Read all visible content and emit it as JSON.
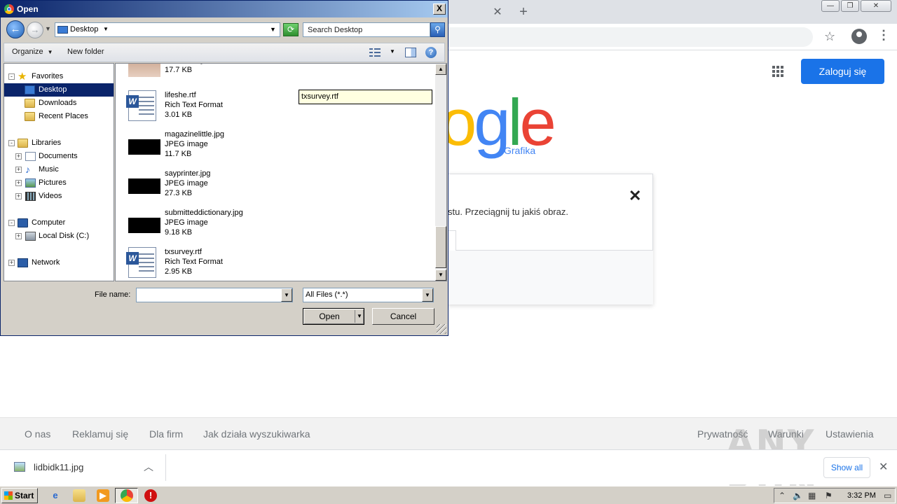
{
  "browser": {
    "tab_close_glyph": "✕",
    "new_tab_glyph": "+",
    "signin_label": "Zaloguj się",
    "logo_text": [
      "o",
      "g",
      "l",
      "e"
    ],
    "logo_sub": "Grafika",
    "panel_text": "stu. Przeciągnij tu jakiś obraz.",
    "panel_close_glyph": "✕",
    "footer_left": [
      "O nas",
      "Reklamuj się",
      "Dla firm",
      "Jak działa wyszukiwarka"
    ],
    "footer_right": [
      "Prywatność",
      "Warunki",
      "Ustawienia"
    ],
    "watermark": "ANY RUN",
    "colors": {
      "signin_bg": "#1a73e8",
      "blue": "#4285f4",
      "red": "#ea4335",
      "yellow": "#fbbc05",
      "green": "#34a853"
    }
  },
  "downloads": {
    "file_name": "lidbidk11.jpg",
    "show_all": "Show all"
  },
  "dialog": {
    "title": "Open",
    "close_glyph": "X",
    "address": "Desktop",
    "search_placeholder": "Search Desktop",
    "toolbar": {
      "organize": "Organize",
      "new_folder": "New folder"
    },
    "nav_tree": [
      {
        "label": "Favorites",
        "icon": "star-icon",
        "expander": "-"
      },
      {
        "label": "Desktop",
        "icon": "desktop-icon",
        "selected": true
      },
      {
        "label": "Downloads",
        "icon": "folder-icon"
      },
      {
        "label": "Recent Places",
        "icon": "folder-icon"
      },
      {
        "label": "Libraries",
        "icon": "folder-icon",
        "expander": "-"
      },
      {
        "label": "Documents",
        "icon": "document-icon",
        "expander": "+"
      },
      {
        "label": "Music",
        "icon": "music-icon",
        "expander": "+"
      },
      {
        "label": "Pictures",
        "icon": "pictures-icon",
        "expander": "+"
      },
      {
        "label": "Videos",
        "icon": "videos-icon",
        "expander": "+"
      },
      {
        "label": "Computer",
        "icon": "computer-icon",
        "expander": "-"
      },
      {
        "label": "Local Disk (C:)",
        "icon": "disk-icon",
        "expander": "+"
      },
      {
        "label": "Network",
        "icon": "network-icon",
        "expander": "+"
      }
    ],
    "files": [
      {
        "name": "",
        "type": "JPEG image",
        "size": "17.7 KB",
        "thumb": "photo"
      },
      {
        "name": "lifeshe.rtf",
        "type": "Rich Text Format",
        "size": "3.01 KB",
        "thumb": "rtf"
      },
      {
        "name": "magazinelittle.jpg",
        "type": "JPEG image",
        "size": "11.7 KB",
        "thumb": "black"
      },
      {
        "name": "sayprinter.jpg",
        "type": "JPEG image",
        "size": "27.3 KB",
        "thumb": "black"
      },
      {
        "name": "submitteddictionary.jpg",
        "type": "JPEG image",
        "size": "9.18 KB",
        "thumb": "black"
      },
      {
        "name": "txsurvey.rtf",
        "type": "Rich Text Format",
        "size": "2.95 KB",
        "thumb": "rtf"
      }
    ],
    "rename_tooltip": "txsurvey.rtf",
    "file_name_label": "File name:",
    "file_name_value": "",
    "file_type": "All Files (*.*)",
    "open_label": "Open",
    "cancel_label": "Cancel"
  },
  "taskbar": {
    "start_label": "Start",
    "clock": "3:32 PM"
  }
}
